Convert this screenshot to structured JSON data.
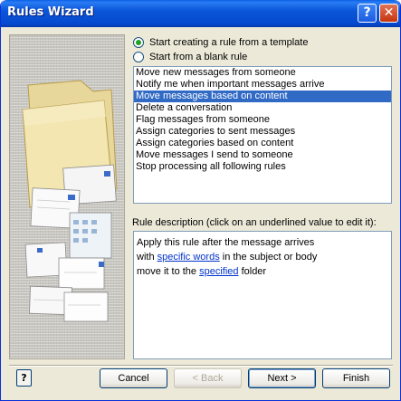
{
  "window": {
    "title": "Rules Wizard"
  },
  "titlebar": {
    "help_glyph": "?",
    "close_glyph": "✕"
  },
  "options": [
    {
      "label": "Start creating a rule from a template",
      "checked": true
    },
    {
      "label": "Start from a blank rule",
      "checked": false
    }
  ],
  "templates": [
    "Move new messages from someone",
    "Notify me when important messages arrive",
    "Move messages based on content",
    "Delete a conversation",
    "Flag messages from someone",
    "Assign categories to sent messages",
    "Assign categories based on content",
    "Move messages I send to someone",
    "Stop processing all following rules"
  ],
  "selected_template": "Move messages based on content",
  "description": {
    "label": "Rule description (click on an underlined value to edit it):",
    "line1": "Apply this rule after the message arrives",
    "line2_prefix": "with ",
    "line2_link": "specific words",
    "line2_suffix": " in the subject or body",
    "line3_prefix": "move it to the ",
    "line3_link": "specified",
    "line3_suffix": " folder"
  },
  "buttons": {
    "help": "?",
    "cancel": "Cancel",
    "back": "< Back",
    "next": "Next >",
    "finish": "Finish"
  },
  "colors": {
    "titlebar": "#0a55d8",
    "selection": "#316ac5",
    "link": "#0033cc",
    "dialog_bg": "#ece9d8"
  }
}
